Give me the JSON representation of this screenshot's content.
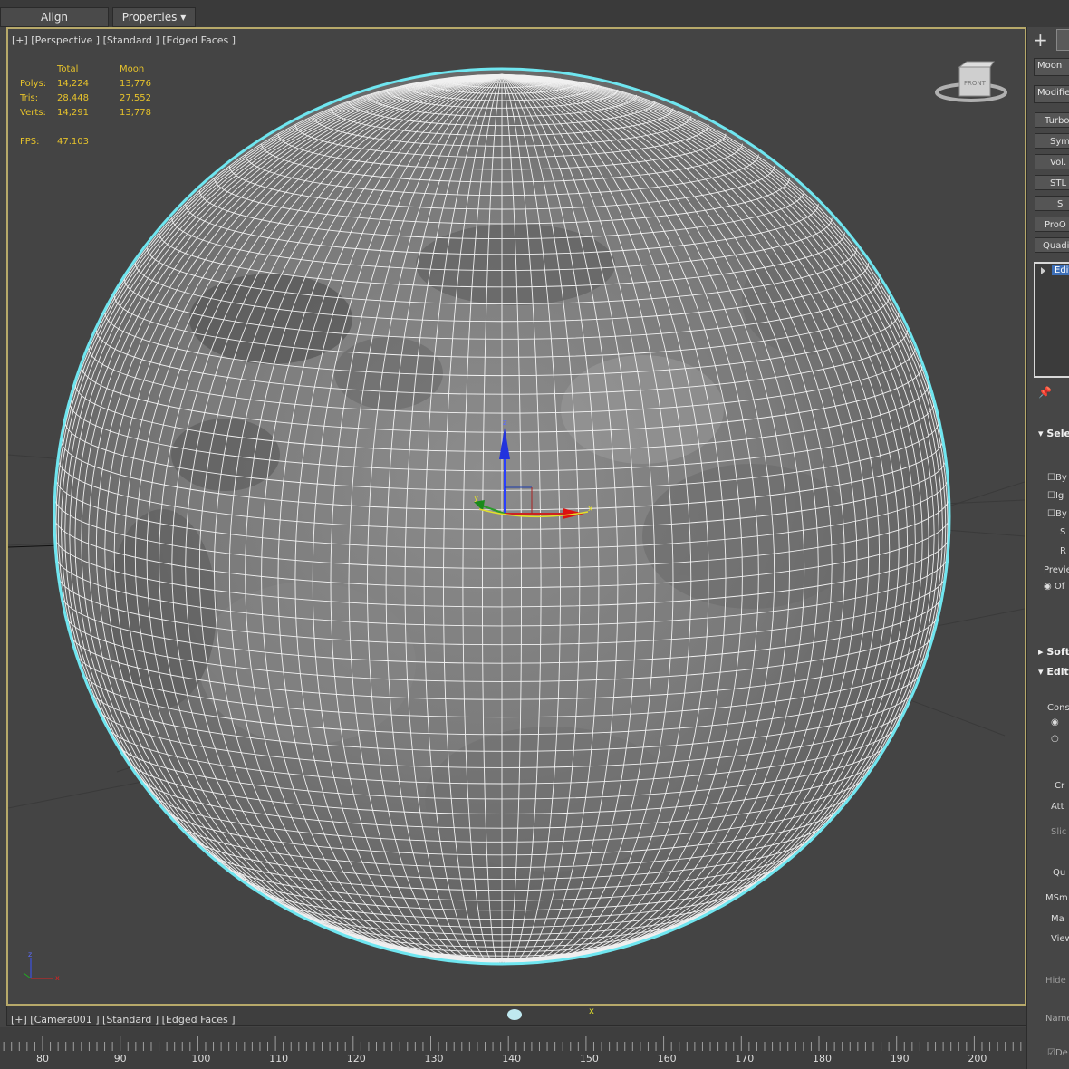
{
  "toolbar": {
    "align_label": "Align",
    "properties_label": "Properties ▾"
  },
  "viewport": {
    "label": "[+] [Perspective ] [Standard ] [Edged Faces ]",
    "stats": {
      "headers": [
        "Total",
        "Moon"
      ],
      "rows": [
        {
          "label": "Polys:",
          "total": "14,224",
          "moon": "13,776"
        },
        {
          "label": "Tris:",
          "total": "28,448",
          "moon": "27,552"
        },
        {
          "label": "Verts:",
          "total": "14,291",
          "moon": "13,778"
        }
      ],
      "fps_label": "FPS:",
      "fps_value": "47.103"
    },
    "viewcube_label": "FRONT",
    "gizmo_labels": {
      "x": "x",
      "y": "y",
      "z": "z"
    }
  },
  "bottom_viewport": {
    "label": "[+] [Camera001 ] [Standard ] [Edged Faces ]",
    "axis_x": "x"
  },
  "timeline": {
    "ticks": [
      "80",
      "90",
      "100",
      "110",
      "120",
      "130",
      "140",
      "150",
      "160",
      "170",
      "180",
      "190",
      "200"
    ]
  },
  "command_panel": {
    "object_name": "Moon",
    "modifier_list": "Modifier",
    "modifier_buttons": [
      "Turbo",
      "Sym",
      "Vol.",
      "STL",
      "S",
      "ProO",
      "Quadi"
    ],
    "stack_item": "Edit",
    "rollouts": {
      "selection": "Sele",
      "by_vertex": "By",
      "ignore": "Ig",
      "by_angle": "By",
      "shrink": "S",
      "ring": "R",
      "preview_label": "Previe",
      "preview_off": "Of",
      "soft": "Soft",
      "edit": "Edit",
      "constraints": "Cons",
      "create": "Cr",
      "attach": "Att",
      "slice": "Slic",
      "quick": "Qu",
      "msmooth": "MSm",
      "make": "Ma",
      "view": "View",
      "hide": "Hide S",
      "named": "Name",
      "delete": "De"
    }
  },
  "colors": {
    "viewport_border": "#b7a96a",
    "stats_text": "#e7c32b",
    "selection_outline": "#6fe6f0",
    "wire": "#ffffff"
  }
}
